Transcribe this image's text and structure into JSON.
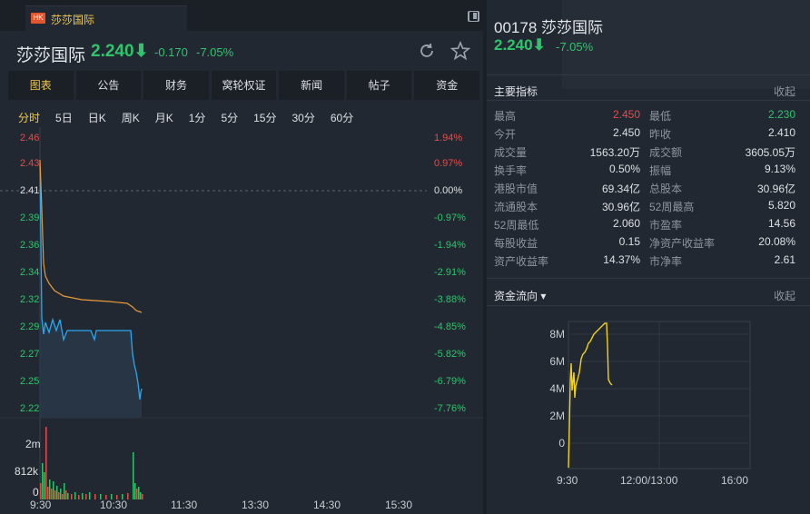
{
  "tab": {
    "badge": "HK",
    "title": "莎莎国际"
  },
  "header": {
    "name": "莎莎国际",
    "price": "2.240⬇",
    "change": "-0.170",
    "pct": "-7.05%"
  },
  "menu": [
    "图表",
    "公告",
    "财务",
    "窝轮权证",
    "新闻",
    "帖子",
    "资金"
  ],
  "periods": [
    "分时",
    "5日",
    "日K",
    "周K",
    "月K",
    "1分",
    "5分",
    "15分",
    "30分",
    "60分"
  ],
  "chart": {
    "price_labels": [
      {
        "v": "2.46",
        "c": "#e54b4b"
      },
      {
        "v": "2.43",
        "c": "#e54b4b"
      },
      {
        "v": "2.41",
        "c": "#dde0e4"
      },
      {
        "v": "2.39",
        "c": "#2ec46b"
      },
      {
        "v": "2.36",
        "c": "#2ec46b"
      },
      {
        "v": "2.34",
        "c": "#2ec46b"
      },
      {
        "v": "2.32",
        "c": "#2ec46b"
      },
      {
        "v": "2.29",
        "c": "#2ec46b"
      },
      {
        "v": "2.27",
        "c": "#2ec46b"
      },
      {
        "v": "2.25",
        "c": "#2ec46b"
      },
      {
        "v": "2.22",
        "c": "#2ec46b"
      }
    ],
    "pct_labels": [
      {
        "v": "1.94%",
        "c": "#e54b4b"
      },
      {
        "v": "0.97%",
        "c": "#e54b4b"
      },
      {
        "v": "0.00%",
        "c": "#dde0e4"
      },
      {
        "v": "-0.97%",
        "c": "#2ec46b"
      },
      {
        "v": "-1.94%",
        "c": "#2ec46b"
      },
      {
        "v": "-2.91%",
        "c": "#2ec46b"
      },
      {
        "v": "-3.88%",
        "c": "#2ec46b"
      },
      {
        "v": "-4.85%",
        "c": "#2ec46b"
      },
      {
        "v": "-5.82%",
        "c": "#2ec46b"
      },
      {
        "v": "-6.79%",
        "c": "#2ec46b"
      },
      {
        "v": "-7.76%",
        "c": "#2ec46b"
      }
    ],
    "vol_labels": [
      "2m",
      "812k",
      "0"
    ],
    "times": [
      "9:30",
      "10:30",
      "11:30",
      "13:30",
      "14:30",
      "15:30"
    ]
  },
  "right": {
    "title": "00178 莎莎国际",
    "price": "2.240⬇",
    "pct": "-7.05%",
    "indicators_title": "主要指标",
    "collapse": "收起",
    "indicators": [
      {
        "l1": "最高",
        "v1": "2.450",
        "c1": "red",
        "l2": "最低",
        "v2": "2.230",
        "c2": "green"
      },
      {
        "l1": "今开",
        "v1": "2.450",
        "c1": "",
        "l2": "昨收",
        "v2": "2.410",
        "c2": ""
      },
      {
        "l1": "成交量",
        "v1": "1563.20万",
        "c1": "",
        "l2": "成交额",
        "v2": "3605.05万",
        "c2": ""
      },
      {
        "l1": "换手率",
        "v1": "0.50%",
        "c1": "",
        "l2": "振幅",
        "v2": "9.13%",
        "c2": ""
      },
      {
        "l1": "港股市值",
        "v1": "69.34亿",
        "c1": "",
        "l2": "总股本",
        "v2": "30.96亿",
        "c2": ""
      },
      {
        "l1": "流通股本",
        "v1": "30.96亿",
        "c1": "",
        "l2": "52周最高",
        "v2": "5.820",
        "c2": ""
      },
      {
        "l1": "52周最低",
        "v1": "2.060",
        "c1": "",
        "l2": "市盈率",
        "v2": "14.56",
        "c2": ""
      },
      {
        "l1": "每股收益",
        "v1": "0.15",
        "c1": "",
        "l2": "净资产收益率",
        "v2": "20.08%",
        "c2": ""
      },
      {
        "l1": "资产收益率",
        "v1": "14.37%",
        "c1": "",
        "l2": "市净率",
        "v2": "2.61",
        "c2": ""
      }
    ],
    "flow_title": "资金流向 ▾",
    "flow_collapse": "收起",
    "flow_y": [
      "8M",
      "6M",
      "4M",
      "2M",
      "0"
    ],
    "flow_x": [
      "9:30",
      "12:00/13:00",
      "16:00"
    ]
  },
  "chart_data": {
    "type": "line",
    "price_series": [
      2.45,
      2.37,
      2.34,
      2.33,
      2.32,
      2.318,
      2.316,
      2.315,
      2.314,
      2.312,
      2.31,
      2.305
    ],
    "avg_series": [
      2.45,
      2.34,
      2.33,
      2.325,
      2.322,
      2.32,
      2.318,
      2.316,
      2.315,
      2.313,
      2.31,
      2.305
    ],
    "ylim": [
      2.22,
      2.46
    ],
    "flow_ylim": [
      -2,
      9
    ],
    "flow_ylabel": "M"
  }
}
